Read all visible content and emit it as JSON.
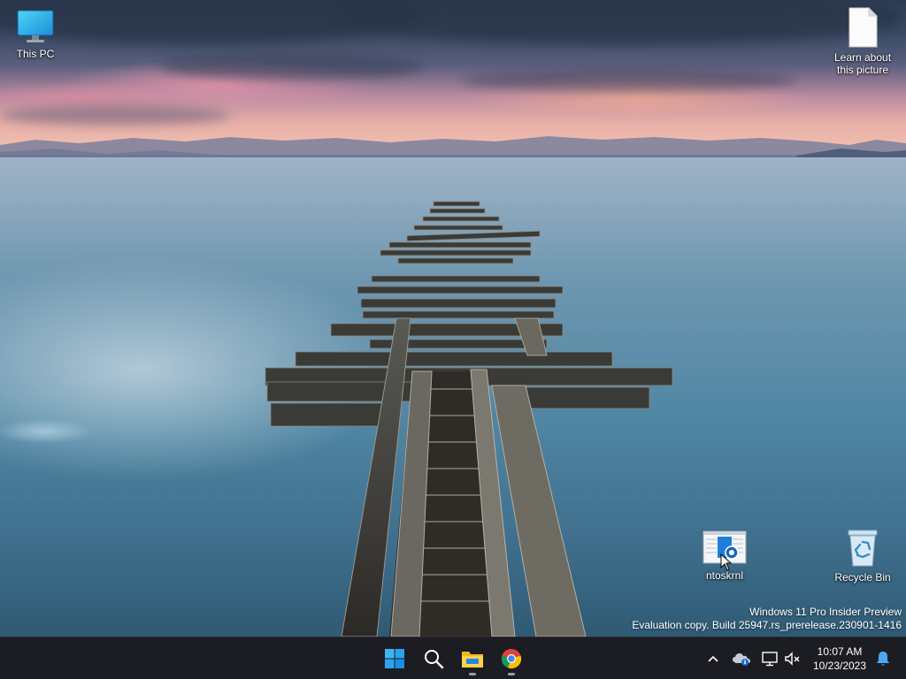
{
  "desktop": {
    "icons": [
      {
        "id": "this-pc",
        "label": "This PC",
        "icon": "monitor-icon"
      },
      {
        "id": "learn",
        "label": "Learn about this picture",
        "icon": "document-icon"
      },
      {
        "id": "ntoskrnl",
        "label": "ntoskrnl",
        "icon": "system-file-icon"
      },
      {
        "id": "recycle-bin",
        "label": "Recycle Bin",
        "icon": "recycle-bin-icon"
      }
    ]
  },
  "watermark": {
    "line1": "Windows 11 Pro Insider Preview",
    "line2": "Evaluation copy. Build 25947.rs_prerelease.230901-1416"
  },
  "taskbar": {
    "pinned": [
      {
        "id": "start",
        "icon": "windows-logo-icon"
      },
      {
        "id": "search",
        "icon": "search-icon"
      },
      {
        "id": "file-explorer",
        "icon": "folder-icon",
        "running": true
      },
      {
        "id": "chrome",
        "icon": "chrome-icon",
        "running": true
      }
    ],
    "tray": {
      "icons": [
        "chevron-up-icon",
        "onedrive-icon",
        "network-icon",
        "volume-muted-icon",
        "notification-bell-icon"
      ],
      "time": "10:07 AM",
      "date": "10/23/2023"
    }
  },
  "colors": {
    "taskbar_bg": "#1c1d22",
    "accent": "#0078d4"
  }
}
